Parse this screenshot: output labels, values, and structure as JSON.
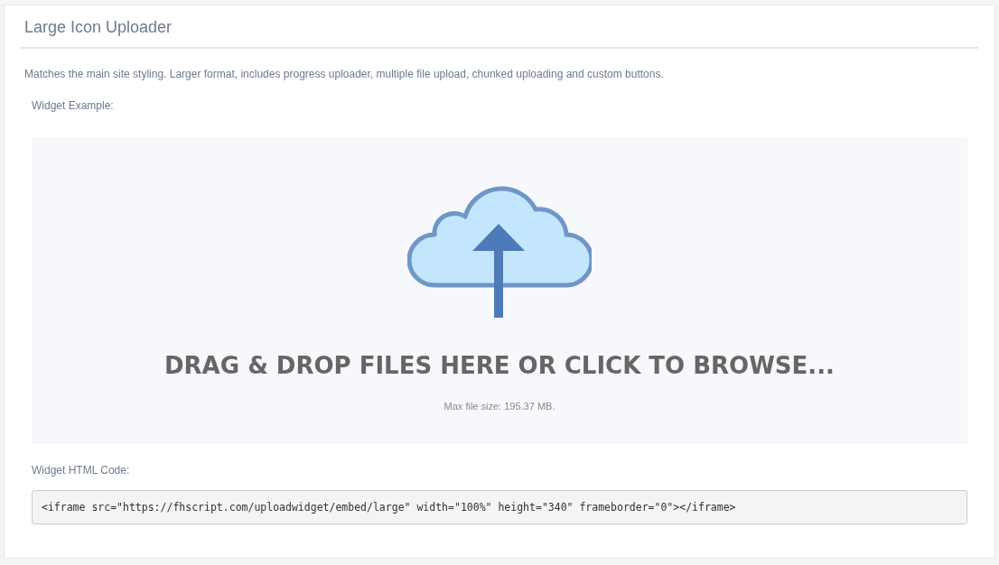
{
  "panel": {
    "title": "Large Icon Uploader",
    "description": "Matches the main site styling. Larger format, includes progress uploader, multiple file upload, chunked uploading and custom buttons."
  },
  "example": {
    "label": "Widget Example:",
    "dropzone": {
      "prompt": "DRAG & DROP FILES HERE OR CLICK TO BROWSE...",
      "max_size": "Max file size: 195.37 MB."
    }
  },
  "code": {
    "label": "Widget HTML Code:",
    "snippet": "<iframe src=\"https://fhscript.com/uploadwidget/embed/large\" width=\"100%\" height=\"340\" frameborder=\"0\"></iframe>"
  }
}
